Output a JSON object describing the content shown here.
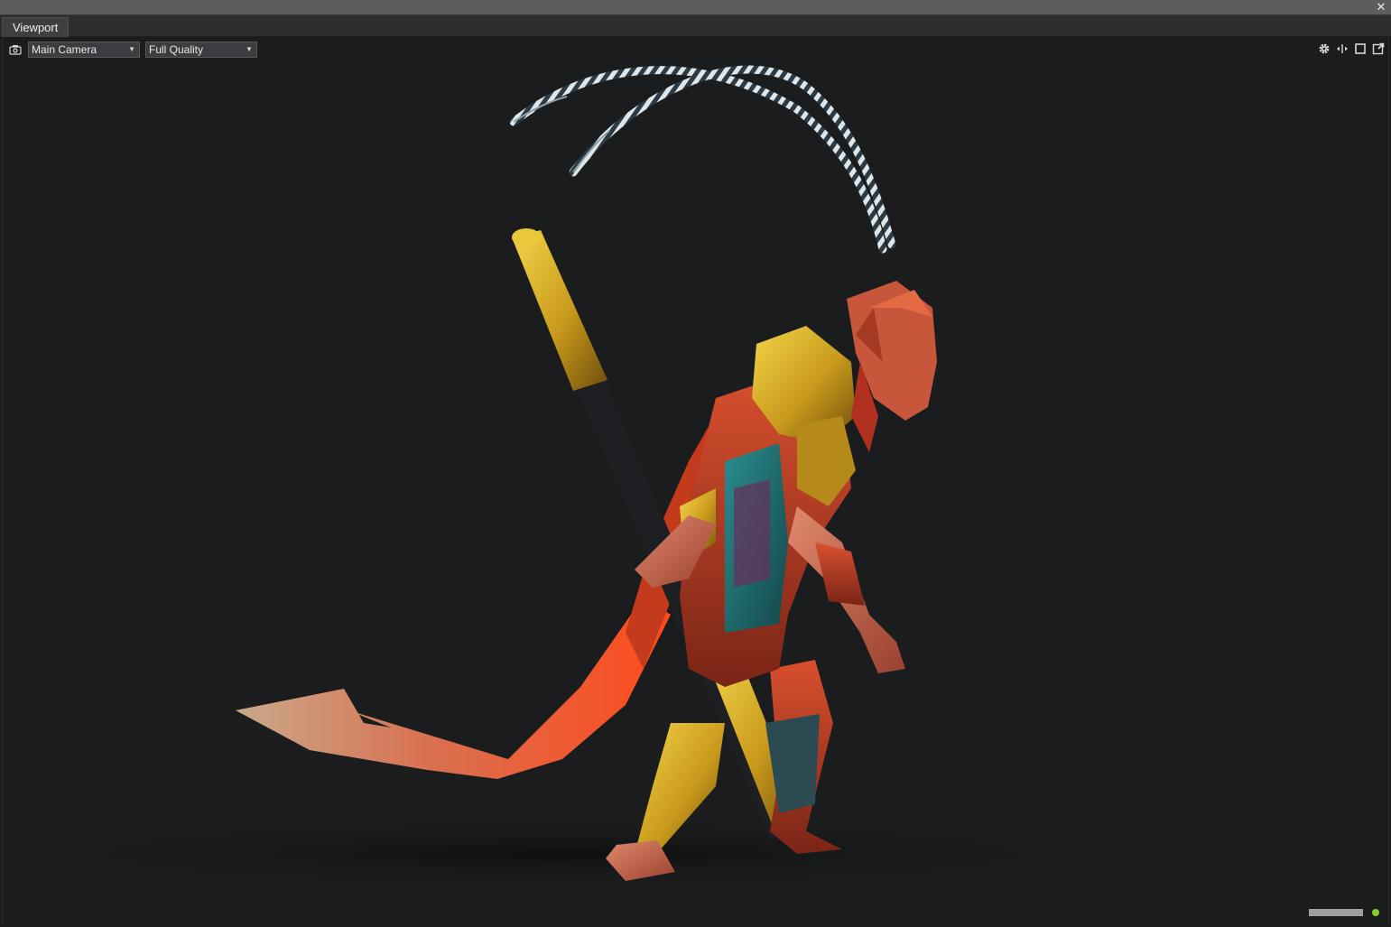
{
  "window": {
    "close_icon": "close-icon"
  },
  "tabs": [
    {
      "label": "Viewport"
    }
  ],
  "viewport": {
    "camera_icon": "camera-icon",
    "camera_select": {
      "value": "Main Camera"
    },
    "quality_select": {
      "value": "Full Quality"
    },
    "tools": [
      {
        "icon": "gear-icon"
      },
      {
        "icon": "resize-horizontal-icon"
      },
      {
        "icon": "maximize-icon"
      },
      {
        "icon": "popout-icon"
      }
    ],
    "scene": {
      "subject": "3D character model",
      "background_color": "#1a1c1e"
    },
    "status": {
      "progress": 1.0,
      "indicator_color": "#7fd12a"
    }
  }
}
